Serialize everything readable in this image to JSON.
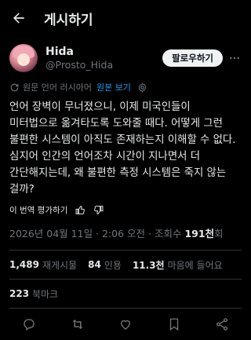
{
  "header": {
    "title": "게시하기"
  },
  "author": {
    "display_name": "Hida",
    "handle": "@Prosto_Hida",
    "follow_label": "팔로우하기"
  },
  "translation": {
    "label": "원문 언어 러시아어",
    "link": "원본 보기"
  },
  "post": {
    "text": "언어 장벽이 무너졌으니, 이제 미국인들이 미터법으로 옮겨타도록 도와줄 때다. 어떻게 그런 불편한 시스템이 아직도 존재하는지 이해할 수 없다. 심지어 인간의 언어조차 시간이 지나면서 더 간단해지는데, 왜 불편한 측정 시스템은 죽지 않는 걸까?"
  },
  "rating": {
    "label": "이 번역 평가하기"
  },
  "meta": {
    "timestamp": "2026년 04월 11일 · 2:06 오전 · 조회수 ",
    "views": "191천",
    "views_suffix": "회"
  },
  "stats": {
    "reposts_num": "1,489",
    "reposts_label": "재게시물",
    "quotes_num": "84",
    "quotes_label": "인용",
    "likes_num": "11.3천",
    "likes_label": "마음에 들어요",
    "bookmarks_num": "223",
    "bookmarks_label": "북마크"
  },
  "icons": {
    "back": "arrow-left-icon",
    "more": "more-dots-icon",
    "translate": "translate-icon",
    "gear": "gear-icon",
    "thumb_up": "thumb-up-icon",
    "thumb_down": "thumb-down-icon",
    "reply": "reply-icon",
    "repost": "repost-icon",
    "like": "heart-icon",
    "bookmark": "bookmark-icon",
    "share": "share-icon"
  },
  "colors": {
    "accent": "#1d9bf0",
    "muted": "#71767b",
    "text": "#e7e9ea",
    "background": "#000000"
  }
}
